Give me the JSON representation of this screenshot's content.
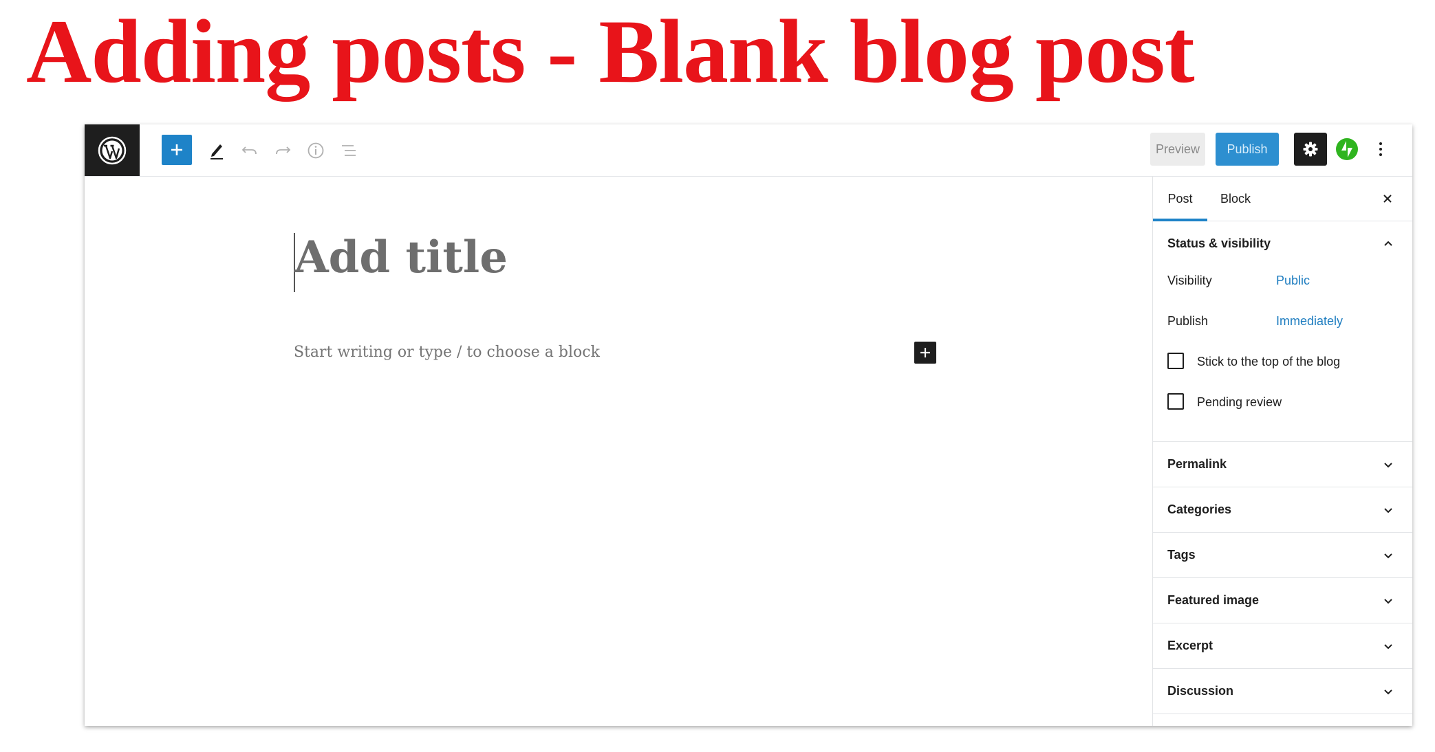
{
  "slide": {
    "title": "Adding posts - Blank blog post"
  },
  "toolbar": {
    "preview_label": "Preview",
    "publish_label": "Publish",
    "icons": [
      "wordpress-logo",
      "plus-icon",
      "pencil-icon",
      "undo-icon",
      "redo-icon",
      "info-icon",
      "list-view-icon",
      "gear-icon",
      "jetpack-icon",
      "more-vertical-icon"
    ]
  },
  "editor": {
    "title_placeholder": "Add title",
    "body_placeholder": "Start writing or type / to choose a block"
  },
  "sidebar": {
    "tabs": [
      {
        "label": "Post"
      },
      {
        "label": "Block"
      }
    ],
    "status": {
      "heading": "Status & visibility",
      "visibility_label": "Visibility",
      "visibility_value": "Public",
      "publish_label": "Publish",
      "publish_value": "Immediately",
      "sticky_label": "Stick to the top of the blog",
      "pending_label": "Pending review"
    },
    "panels": [
      {
        "label": "Permalink"
      },
      {
        "label": "Categories"
      },
      {
        "label": "Tags"
      },
      {
        "label": "Featured image"
      },
      {
        "label": "Excerpt"
      },
      {
        "label": "Discussion"
      }
    ]
  },
  "colors": {
    "accent": "#1e83c8",
    "title_red": "#e8141a",
    "dark": "#1e1e1e"
  }
}
